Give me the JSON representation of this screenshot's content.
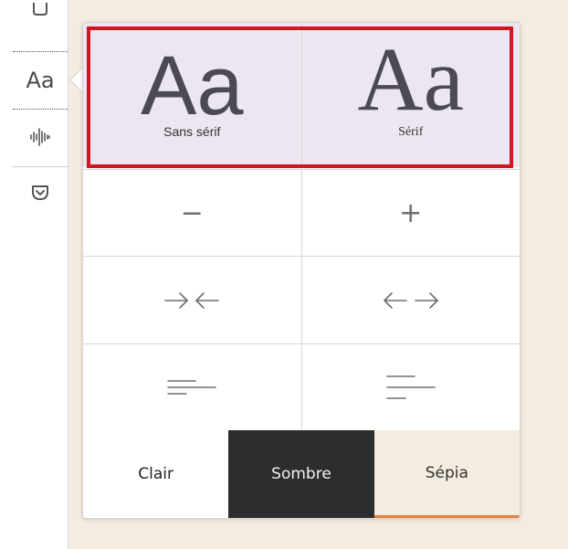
{
  "toolbar": {
    "type_label": "Aa",
    "icons": [
      "close-icon",
      "type-controls-icon",
      "narrate-icon",
      "pocket-icon"
    ]
  },
  "fonts": {
    "sans": {
      "sample": "Aa",
      "label": "Sans sérif"
    },
    "serif": {
      "sample": "Aa",
      "label": "Sérif"
    }
  },
  "size": {
    "decrease": "−",
    "increase": "+"
  },
  "width": {
    "narrow": "→←",
    "wide": "←→"
  },
  "themes": {
    "light": "Clair",
    "dark": "Sombre",
    "sepia": "Sépia"
  },
  "colors": {
    "highlight": "#d0171f",
    "font_row_bg": "#ece6f0",
    "dark_theme_bg": "#2d2d2d",
    "sepia_theme_bg": "#f4ecdf",
    "sepia_accent": "#e3823f"
  }
}
